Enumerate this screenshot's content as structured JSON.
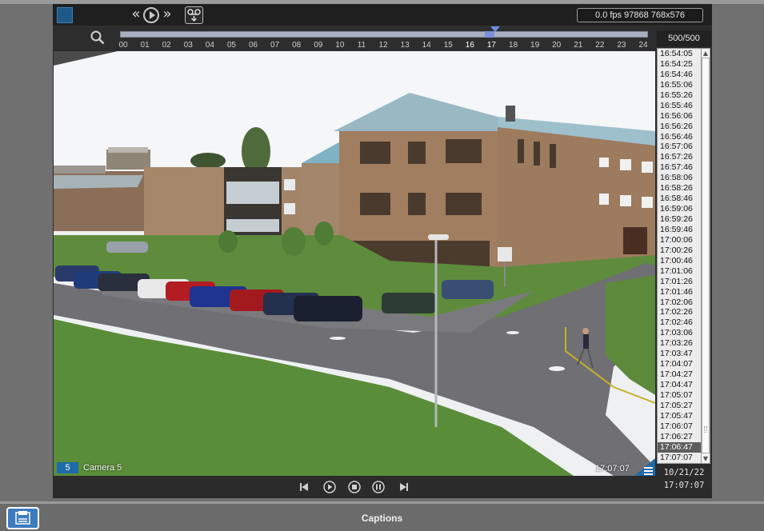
{
  "toolbar": {
    "status": "0.0 fps  97868 768x576",
    "buttons": [
      "rewind",
      "play",
      "fast-forward",
      "export"
    ]
  },
  "timeline": {
    "ticks": [
      "00",
      "01",
      "02",
      "03",
      "04",
      "05",
      "06",
      "07",
      "08",
      "09",
      "10",
      "11",
      "12",
      "13",
      "14",
      "15",
      "16",
      "17",
      "18",
      "19",
      "20",
      "21",
      "22",
      "23",
      "24"
    ],
    "position_hour": 17,
    "counter": "500/500"
  },
  "video": {
    "camera_number": "5",
    "camera_name": "Camera 5",
    "timestamp": "17:07:07"
  },
  "timelist": {
    "items": [
      "16:54:05",
      "16:54:25",
      "16:54:46",
      "16:55:06",
      "16:55:26",
      "16:55:46",
      "16:56:06",
      "16:56:26",
      "16:56:46",
      "16:57:06",
      "16:57:26",
      "16:57:46",
      "16:58:06",
      "16:58:26",
      "16:58:46",
      "16:59:06",
      "16:59:26",
      "16:59:46",
      "17:00:06",
      "17:00:26",
      "17:00:46",
      "17:01:06",
      "17:01:26",
      "17:01:46",
      "17:02:06",
      "17:02:26",
      "17:02:46",
      "17:03:06",
      "17:03:26",
      "17:03:47",
      "17:04:07",
      "17:04:27",
      "17:04:47",
      "17:05:07",
      "17:05:27",
      "17:05:47",
      "17:06:07",
      "17:06:27",
      "17:06:47",
      "17:07:07"
    ],
    "selected_index": 38
  },
  "datetime": {
    "date": "10/21/22",
    "time": "17:07:07"
  },
  "footer": {
    "captions": "Captions"
  },
  "colors": {
    "accent": "#1e6aa8",
    "selected_row": "#5c5c5c",
    "timeline_marker": "#6e8fe0"
  }
}
